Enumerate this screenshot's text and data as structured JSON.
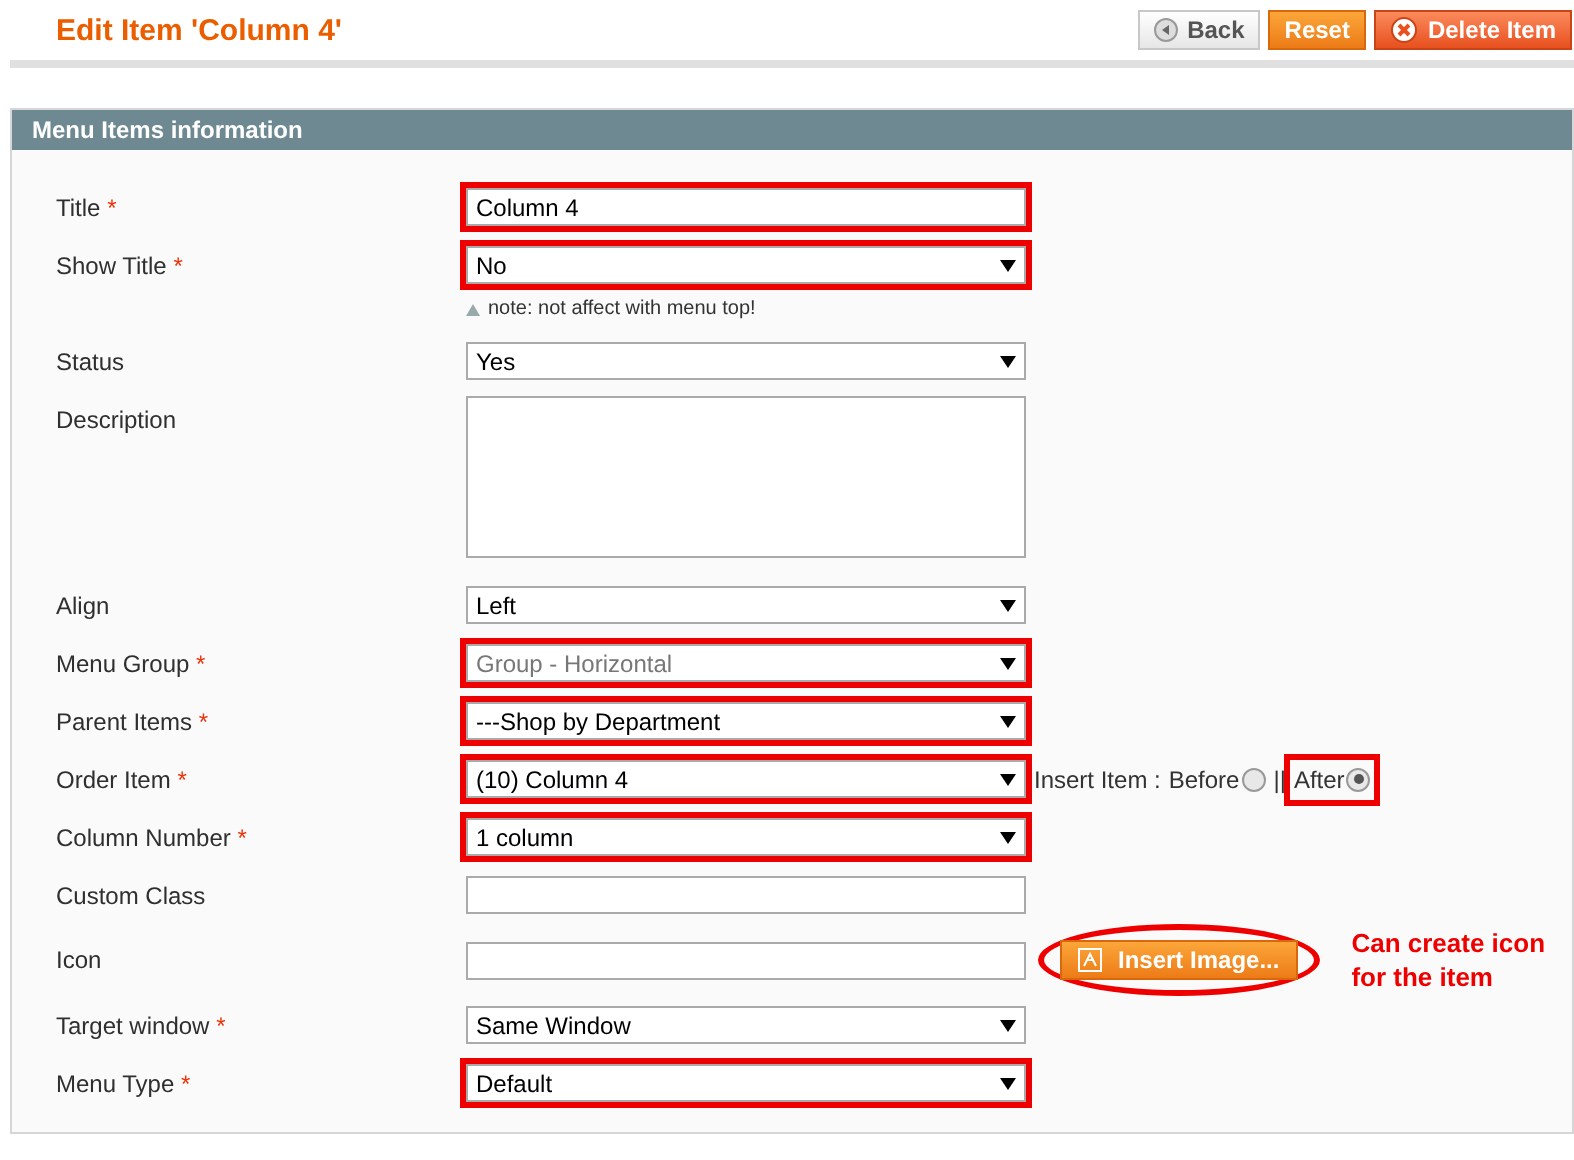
{
  "page_title": "Edit Item 'Column 4'",
  "buttons": [
    {
      "kind": "back",
      "label": "Back"
    },
    {
      "kind": "reset",
      "label": "Reset"
    },
    {
      "kind": "delete",
      "label": "Delete Item"
    }
  ],
  "section_title": "Menu Items information",
  "fields": [
    {
      "kind": "text",
      "label": "Title",
      "mark": "*",
      "value": "Column 4",
      "highlighted": true
    },
    {
      "kind": "select",
      "label": "Show Title",
      "mark": "*",
      "value": "No",
      "highlighted": true,
      "disabled": false,
      "note": "note: not affect with menu top!"
    },
    {
      "kind": "select",
      "label": "Status",
      "value": "Yes",
      "highlighted": false,
      "disabled": false
    },
    {
      "kind": "textarea",
      "label": "Description",
      "highlighted": false
    },
    {
      "kind": "select",
      "label": "Align",
      "value": "Left",
      "highlighted": false,
      "disabled": false
    },
    {
      "kind": "select",
      "label": "Menu Group",
      "mark": "*",
      "value": "Group - Horizontal",
      "highlighted": true,
      "disabled": true
    },
    {
      "kind": "select",
      "label": "Parent Items",
      "mark": "*",
      "value": "---Shop by Department",
      "highlighted": true,
      "disabled": false
    },
    {
      "kind": "select",
      "label": "Order Item",
      "mark": "*",
      "value": "(10) Column 4",
      "highlighted": true,
      "disabled": false,
      "insert": {
        "label": "Insert Item : ",
        "separator": "||",
        "options": [
          {
            "label": "Before",
            "selected": false,
            "highlighted": false
          },
          {
            "label": "After",
            "selected": true,
            "highlighted": true
          }
        ]
      }
    },
    {
      "kind": "select",
      "label": "Column Number",
      "mark": "*",
      "value": "1 column",
      "highlighted": true,
      "disabled": false
    },
    {
      "kind": "text",
      "label": "Custom Class",
      "highlighted": false
    },
    {
      "kind": "text",
      "label": "Icon",
      "highlighted": false,
      "button": {
        "label": "Insert Image...",
        "highlighted": true
      },
      "annotation": "Can create icon for the item"
    },
    {
      "kind": "select",
      "label": "Target window",
      "mark": "*",
      "value": "Same Window",
      "highlighted": false,
      "disabled": false
    },
    {
      "kind": "select",
      "label": "Menu Type",
      "mark": "*",
      "value": "Default",
      "highlighted": true,
      "disabled": false
    }
  ]
}
